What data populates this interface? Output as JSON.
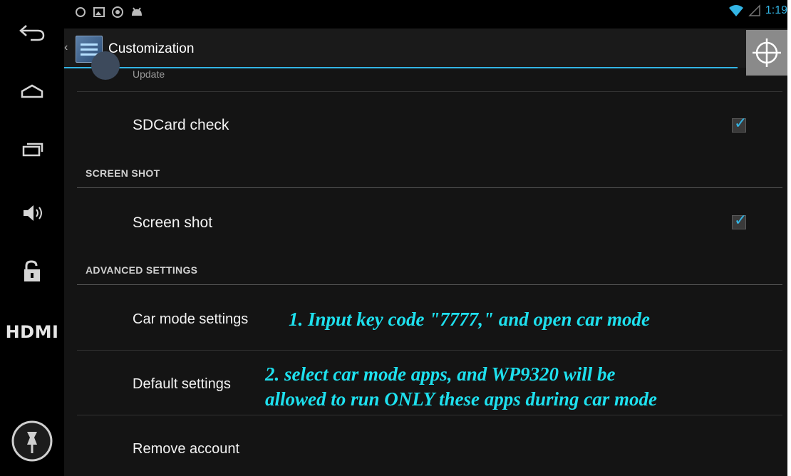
{
  "status_bar": {
    "time": "1:19"
  },
  "action_bar": {
    "title": "Customization"
  },
  "nav_rail": {
    "hdmi_label": "HDMI"
  },
  "list": {
    "update_label": "Update",
    "sdcard_check": {
      "label": "SDCard check",
      "checked": true
    },
    "screen_shot_header": "SCREEN SHOT",
    "screen_shot": {
      "label": "Screen shot",
      "checked": true
    },
    "advanced_header": "ADVANCED SETTINGS",
    "car_mode_settings": "Car mode settings",
    "default_settings": "Default settings",
    "remove_account": "Remove account"
  },
  "annotations": {
    "step1": "1. Input key code \"7777,\" and open car mode",
    "step2_line1": "2. select car mode apps, and WP9320 will be",
    "step2_line2": "allowed to run ONLY these apps during car mode"
  },
  "colors": {
    "accent": "#33b5e5",
    "annotation": "#1ee0ee",
    "background": "#141414"
  }
}
